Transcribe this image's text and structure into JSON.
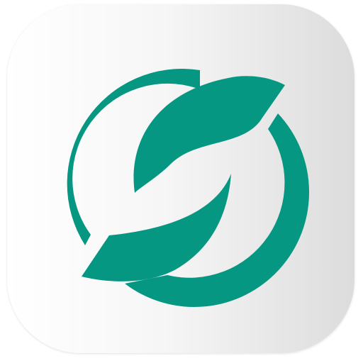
{
  "icon": {
    "name": "app-icon",
    "symbol": "circular-leaf-swirl-logo",
    "colors": {
      "background_light": "#ffffff",
      "background_dark": "#dcdcdc",
      "accent": "#069783"
    }
  }
}
